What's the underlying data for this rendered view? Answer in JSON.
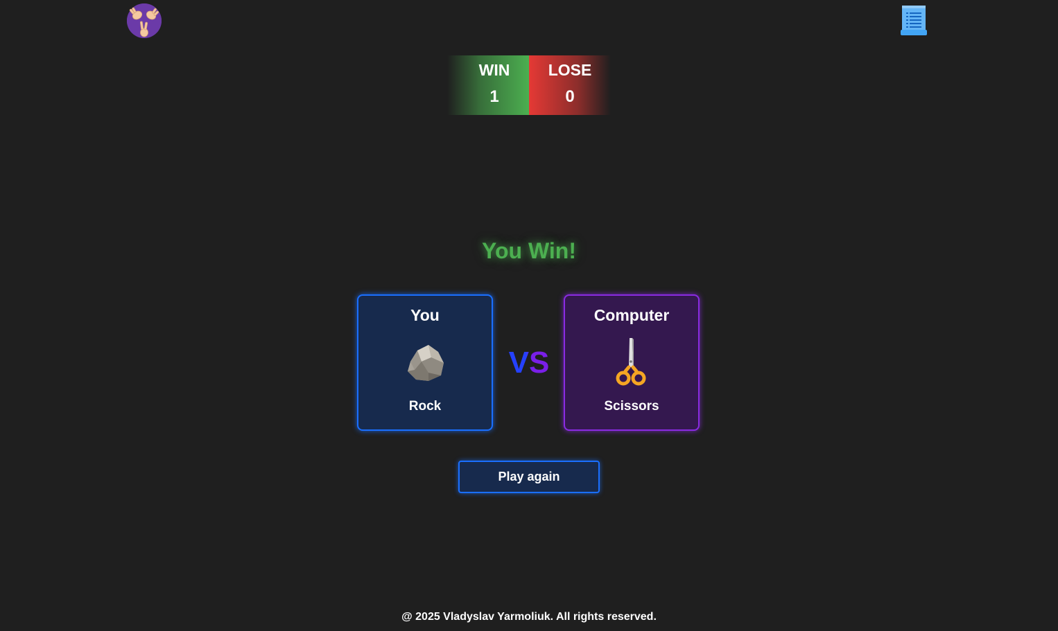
{
  "header": {
    "logo_icon": "rock-paper-scissors-hands-icon",
    "rules_icon": "scroll-list-icon"
  },
  "scoreboard": {
    "win_label": "WIN",
    "win_value": "1",
    "lose_label": "LOSE",
    "lose_value": "0",
    "win_color": "#4caf50",
    "lose_color": "#e53935"
  },
  "result": {
    "text": "You Win!",
    "color": "#4caf50"
  },
  "player": {
    "title": "You",
    "choice": "Rock",
    "icon": "rock-icon",
    "accent": "#1a6fff"
  },
  "versus": {
    "text": "VS"
  },
  "computer": {
    "title": "Computer",
    "choice": "Scissors",
    "icon": "scissors-icon",
    "accent": "#8a2be2"
  },
  "actions": {
    "play_again_label": "Play again"
  },
  "footer": {
    "text": "@ 2025 Vladyslav Yarmoliuk. All rights reserved."
  }
}
